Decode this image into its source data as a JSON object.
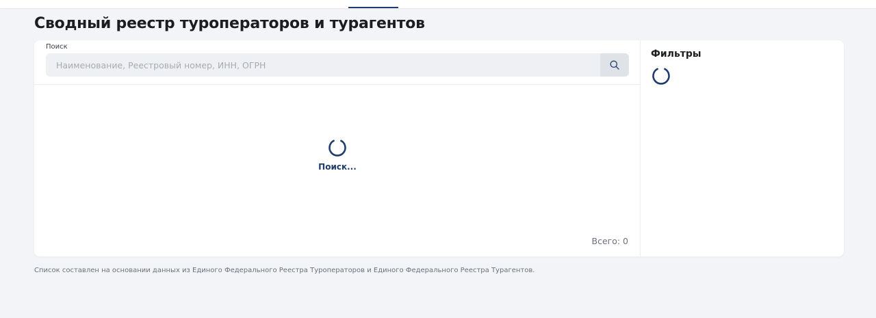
{
  "page": {
    "title": "Сводный реестр туроператоров и турагентов"
  },
  "search": {
    "label": "Поиск",
    "placeholder": "Наименование, Реестровый номер, ИНН, ОГРН",
    "value": ""
  },
  "results": {
    "loading_text": "Поиск...",
    "total_label": "Всего: 0"
  },
  "filters": {
    "title": "Фильтры"
  },
  "footer": {
    "note": "Список составлен на основании данных из Единого Федерального Реестра Туроператоров и Единого Федерального Реестра Турагентов."
  },
  "colors": {
    "accent": "#1f3c6e",
    "background": "#f3f4f7",
    "card": "#ffffff"
  },
  "icons": {
    "search_button": "search-icon",
    "loader": "spinner-icon"
  }
}
